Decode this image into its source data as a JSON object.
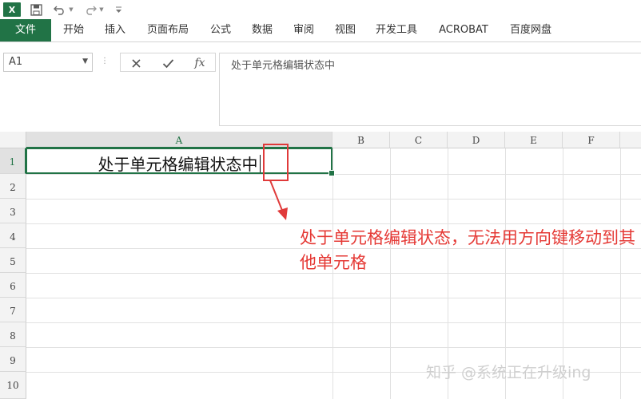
{
  "app": {
    "logo_letter": "X"
  },
  "ribbon": {
    "tabs": [
      {
        "label": "文件",
        "active": true
      },
      {
        "label": "开始"
      },
      {
        "label": "插入"
      },
      {
        "label": "页面布局"
      },
      {
        "label": "公式"
      },
      {
        "label": "数据"
      },
      {
        "label": "审阅"
      },
      {
        "label": "视图"
      },
      {
        "label": "开发工具"
      },
      {
        "label": "ACROBAT"
      },
      {
        "label": "百度网盘"
      }
    ]
  },
  "formula_bar": {
    "name_box": "A1",
    "fx_label": "fx",
    "content": "处于单元格编辑状态中"
  },
  "grid": {
    "columns": [
      "A",
      "B",
      "C",
      "D",
      "E",
      "F"
    ],
    "rows": [
      "1",
      "2",
      "3",
      "4",
      "5",
      "6",
      "7",
      "8",
      "9",
      "10"
    ],
    "cell_a1": "处于单元格编辑状态中"
  },
  "annotation": {
    "note": "处于单元格编辑状态，无法用方向键移动到其他单元格",
    "color": "#e53935"
  },
  "watermark": "知乎 @系统正在升级ing",
  "colors": {
    "accent": "#217346",
    "annotation": "#e03a3a"
  }
}
